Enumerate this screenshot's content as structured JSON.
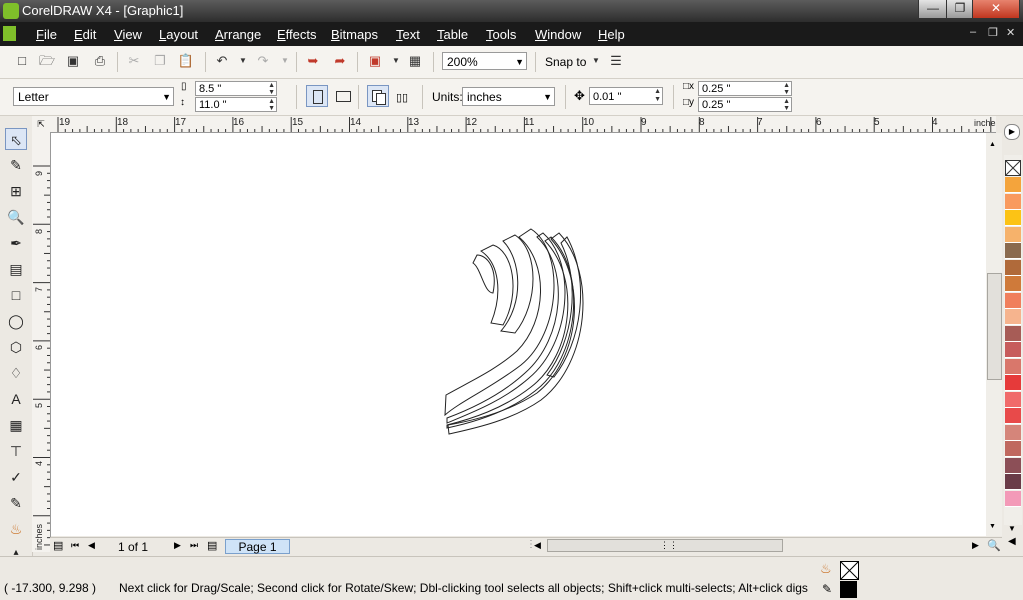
{
  "window": {
    "title": "CorelDRAW X4 - [Graphic1]"
  },
  "menu": [
    "File",
    "Edit",
    "View",
    "Layout",
    "Arrange",
    "Effects",
    "Bitmaps",
    "Text",
    "Table",
    "Tools",
    "Window",
    "Help"
  ],
  "standard_toolbar": {
    "zoom": "200%",
    "snap_to": "Snap to"
  },
  "property_bar": {
    "paper_size": "Letter",
    "width": "8.5 \"",
    "height": "11.0 \"",
    "units_label": "Units:",
    "units": "inches",
    "nudge": "0.01 \"",
    "dup_x": "0.25 \"",
    "dup_y": "0.25 \""
  },
  "rulers": {
    "horizontal": [
      "19",
      "18",
      "17",
      "16",
      "15",
      "14",
      "13",
      "12",
      "11",
      "10",
      "9",
      "8",
      "7",
      "6",
      "5",
      "4"
    ],
    "horizontal_units": "inches",
    "vertical": [
      "9",
      "8",
      "7",
      "6",
      "5",
      "4"
    ],
    "vertical_units": "inches"
  },
  "pages": {
    "count": "1 of 1",
    "tab": "Page 1"
  },
  "palette": [
    "#f4a43c",
    "#f99a5e",
    "#fcc315",
    "#f6b26b",
    "#8a6a4e",
    "#b06a3a",
    "#cf7a3a",
    "#f07f5c",
    "#f6b48e",
    "#a75c56",
    "#c75c5c",
    "#d9776b",
    "#e63a3a",
    "#f06a6a",
    "#e84a4a",
    "#d5857a",
    "#c0685f",
    "#8c4f57",
    "#6a3b48",
    "#f39ab8"
  ],
  "status": {
    "coords": "( -17.300, 9.298 )",
    "hint": "Next click for Drag/Scale; Second click for Rotate/Skew; Dbl-clicking tool selects all objects; Shift+click multi-selects; Alt+click digs"
  }
}
